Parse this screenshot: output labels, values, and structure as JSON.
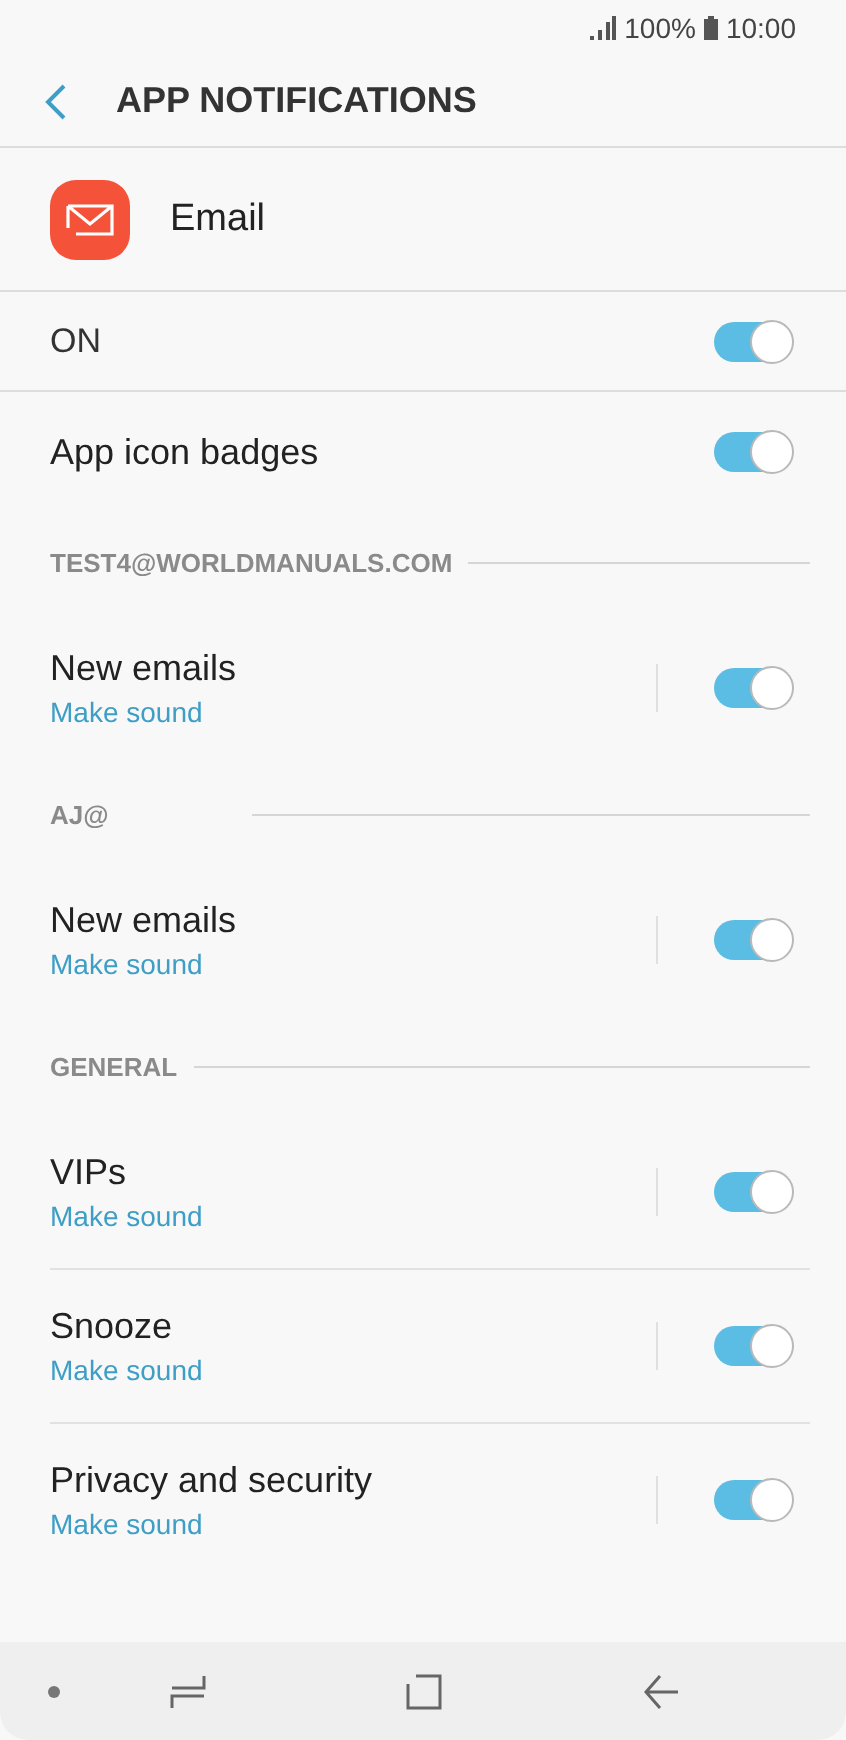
{
  "status_bar": {
    "battery": "100%",
    "time": "10:00"
  },
  "header": {
    "title": "APP NOTIFICATIONS"
  },
  "app": {
    "name": "Email"
  },
  "items": [
    {
      "kind": "master",
      "label": "ON",
      "on": true
    },
    {
      "kind": "toggle",
      "label": "App icon badges",
      "on": true
    },
    {
      "kind": "section",
      "label": "TEST4@WORLDMANUALS.COM"
    },
    {
      "kind": "sub",
      "label": "New emails",
      "sub": "Make sound",
      "on": true
    },
    {
      "kind": "section",
      "label": "AJ@"
    },
    {
      "kind": "sub",
      "label": "New emails",
      "sub": "Make sound",
      "on": true
    },
    {
      "kind": "section",
      "label": "GENERAL"
    },
    {
      "kind": "sub",
      "label": "VIPs",
      "sub": "Make sound",
      "on": true
    },
    {
      "kind": "sub",
      "label": "Snooze",
      "sub": "Make sound",
      "on": true
    },
    {
      "kind": "sub",
      "label": "Privacy and security",
      "sub": "Make sound",
      "on": true
    }
  ]
}
